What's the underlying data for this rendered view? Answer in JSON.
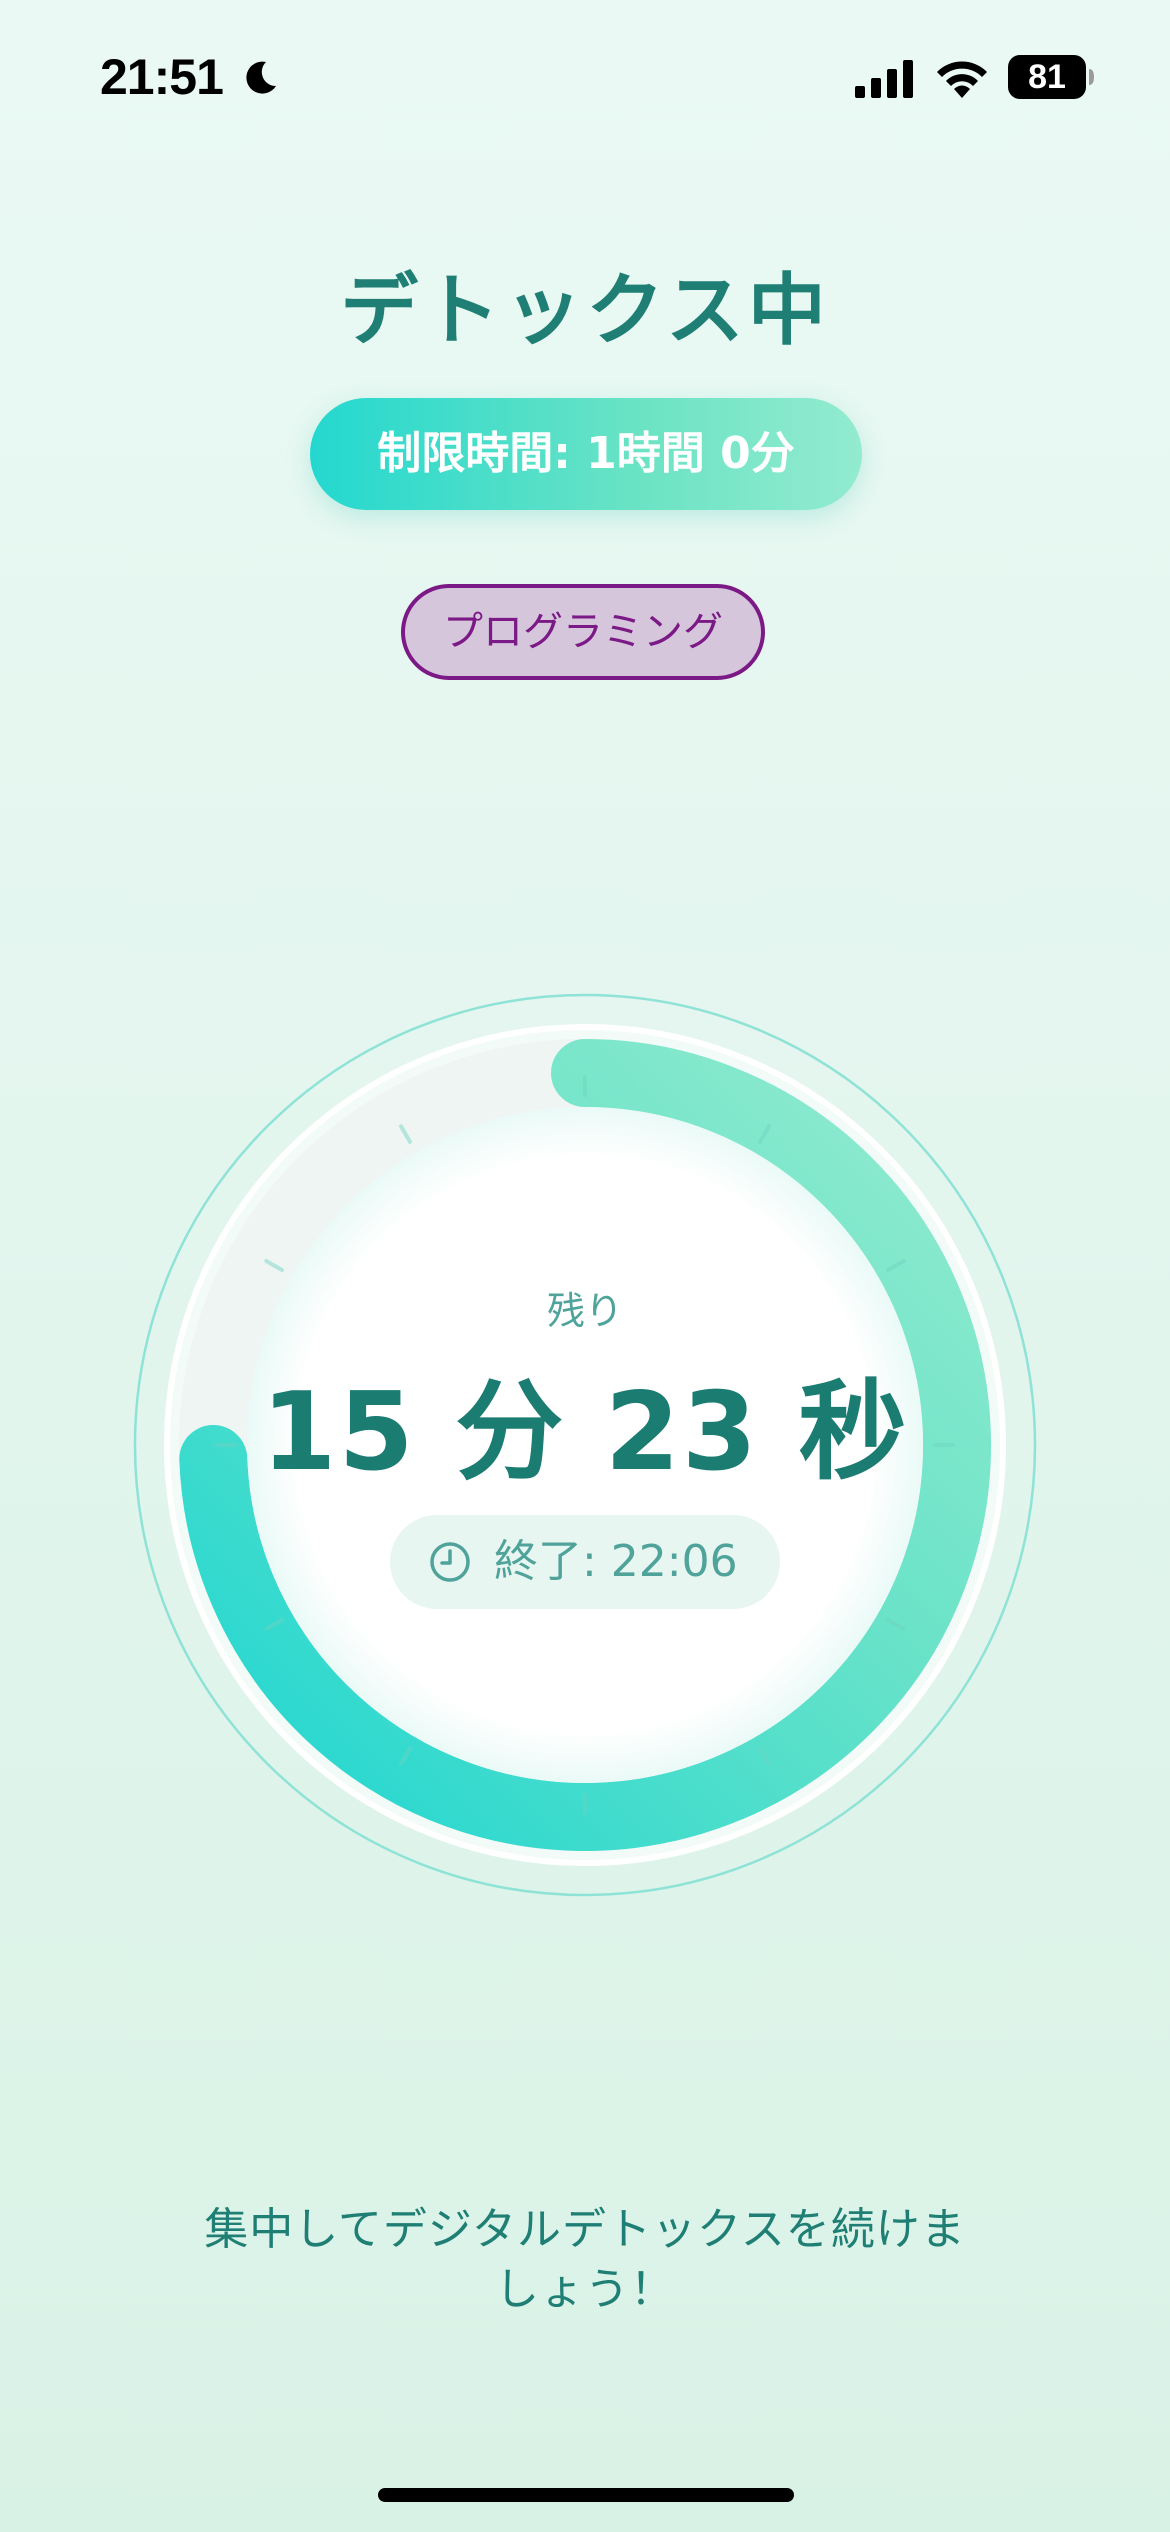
{
  "status_bar": {
    "time": "21:51",
    "battery_level": "81",
    "icons": [
      "moon-icon",
      "signal-icon",
      "wifi-icon",
      "battery-icon"
    ]
  },
  "detox": {
    "title": "デトックス中",
    "time_limit": "制限時間: 1時間 0分",
    "category": "プログラミング",
    "remaining_label": "残り",
    "remaining_time": "15 分 23 秒",
    "end_time": "終了: 22:06",
    "progress_fraction": 0.744,
    "encouragement": "集中してデジタルデトックスを続けましょう！"
  },
  "colors": {
    "accent_start": "#24d8cf",
    "accent_end": "#93ebcf",
    "title": "#1f7f74",
    "category_border": "#7b1a86",
    "category_fill": "#d6c6dc"
  }
}
